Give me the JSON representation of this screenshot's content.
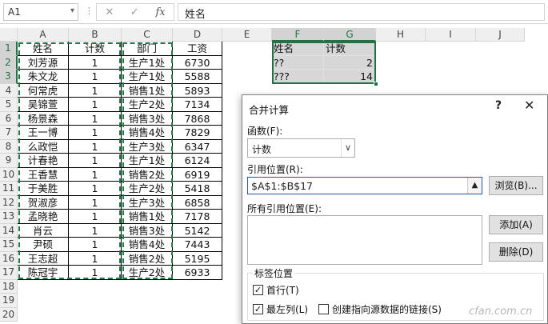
{
  "formula_bar": {
    "name_box": "A1",
    "cancel_icon": "✕",
    "enter_icon": "✓",
    "fx_label": "fx",
    "formula": "姓名"
  },
  "columns": [
    "A",
    "B",
    "C",
    "D",
    "E",
    "F",
    "G",
    "H",
    "I",
    "J"
  ],
  "rows": [
    "1",
    "2",
    "3",
    "4",
    "5",
    "6",
    "7",
    "8",
    "9",
    "10",
    "11",
    "12",
    "13",
    "14",
    "15",
    "16",
    "17",
    "18",
    "19",
    "20"
  ],
  "table": {
    "headers": [
      "姓名",
      "计数",
      "部门",
      "工资"
    ],
    "records": [
      [
        "刘芳源",
        "1",
        "生产1处",
        "6730"
      ],
      [
        "朱文龙",
        "1",
        "生产1处",
        "5588"
      ],
      [
        "何常虎",
        "1",
        "销售1处",
        "5893"
      ],
      [
        "吴锦萱",
        "1",
        "生产2处",
        "7134"
      ],
      [
        "杨景森",
        "1",
        "销售3处",
        "7868"
      ],
      [
        "王一博",
        "1",
        "销售4处",
        "7829"
      ],
      [
        "么政恺",
        "1",
        "生产3处",
        "6347"
      ],
      [
        "计春艳",
        "1",
        "生产1处",
        "6124"
      ],
      [
        "王香慧",
        "1",
        "销售2处",
        "6919"
      ],
      [
        "于美胜",
        "1",
        "生产2处",
        "5418"
      ],
      [
        "贺淑彦",
        "1",
        "生产3处",
        "6858"
      ],
      [
        "孟晓艳",
        "1",
        "销售1处",
        "7178"
      ],
      [
        "肖云",
        "1",
        "销售3处",
        "5142"
      ],
      [
        "尹硕",
        "1",
        "销售4处",
        "7443"
      ],
      [
        "王志超",
        "1",
        "销售2处",
        "5195"
      ],
      [
        "陈冠宇",
        "1",
        "生产2处",
        "6933"
      ]
    ]
  },
  "result": {
    "headers": [
      "姓名",
      "计数"
    ],
    "rows": [
      [
        "??",
        "2"
      ],
      [
        "???",
        "14"
      ]
    ]
  },
  "dialog": {
    "title": "合并计算",
    "help": "?",
    "close": "✕",
    "function_label": "函数(F):",
    "function_value": "计数",
    "reference_label": "引用位置(R):",
    "reference_value": "$A$1:$B$17",
    "browse_button": "浏览(B)...",
    "all_refs_label": "所有引用位置(E):",
    "add_button": "添加(A)",
    "delete_button": "删除(D)",
    "label_group_title": "标签位置",
    "top_row_label": "首行(T)",
    "left_col_label": "最左列(L)",
    "link_label": "创建指向源数据的链接(S)"
  },
  "watermark": "cfan.com.cn"
}
